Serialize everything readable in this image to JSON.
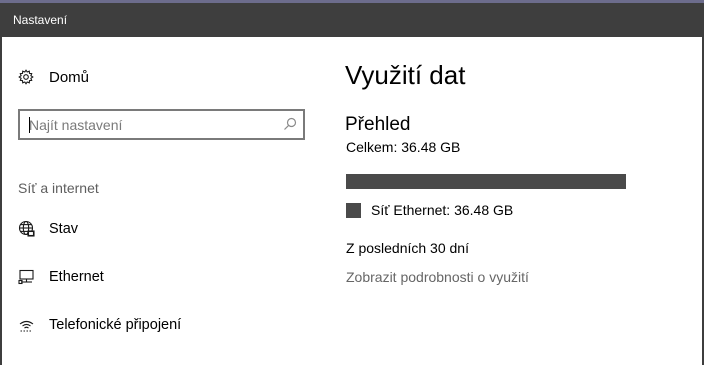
{
  "window": {
    "title": "Nastavení"
  },
  "colors": {
    "titlebar": "#3e3e3e",
    "usage_fill": "#4a4a4a",
    "link": "#666666"
  },
  "sidebar": {
    "home": {
      "label": "Domů",
      "icon": "gear-icon"
    },
    "search": {
      "placeholder": "Najít nastavení",
      "value": "",
      "icon": "search-icon"
    },
    "section_label": "Síť a internet",
    "items": [
      {
        "label": "Stav",
        "icon": "globe-icon"
      },
      {
        "label": "Ethernet",
        "icon": "ethernet-icon"
      },
      {
        "label": "Telefonické připojení",
        "icon": "dialup-icon"
      }
    ]
  },
  "main": {
    "title": "Využití dat",
    "overview": {
      "heading": "Přehled",
      "total": "Celkem: 36.48 GB",
      "usage_fraction": 1.0,
      "legend": [
        {
          "label": "Síť Ethernet: 36.48 GB",
          "color": "#4a4a4a"
        }
      ]
    },
    "period": "Z posledních 30 dní",
    "details_link": "Zobrazit podrobnosti o využití"
  }
}
